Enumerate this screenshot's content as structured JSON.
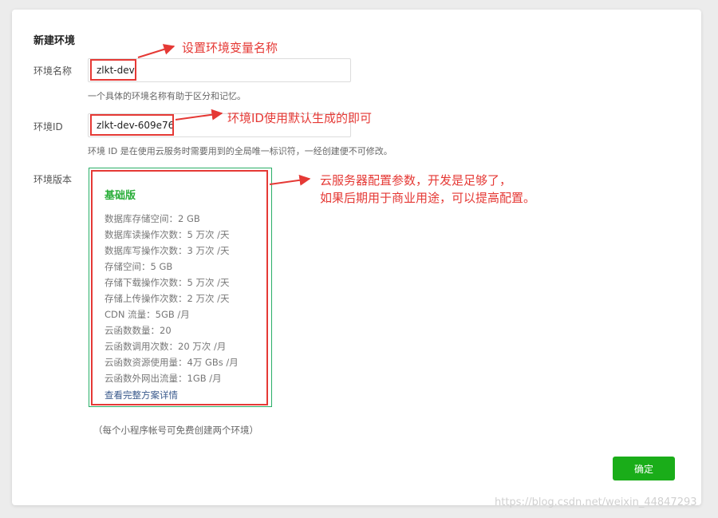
{
  "form": {
    "title": "新建环境",
    "env_name": {
      "label": "环境名称",
      "value": "zlkt-dev",
      "hint": "一个具体的环境名称有助于区分和记忆。"
    },
    "env_id": {
      "label": "环境ID",
      "value": "zlkt-dev-609e76",
      "hint": "环境 ID 是在使用云服务时需要用到的全局唯一标识符，一经创建便不可修改。"
    },
    "env_version": {
      "label": "环境版本",
      "plan": {
        "name": "基础版",
        "specs": [
          "数据库存储空间：2 GB",
          "数据库读操作次数：5 万次 /天",
          "数据库写操作次数：3 万次 /天",
          "存储空间：5 GB",
          "存储下载操作次数：5 万次 /天",
          "存储上传操作次数：2 万次 /天",
          "CDN 流量：5GB /月",
          "云函数数量：20",
          "云函数调用次数：20 万次 /月",
          "云函数资源使用量：4万 GBs /月",
          "云函数外网出流量：1GB /月"
        ],
        "details_link": "查看完整方案详情"
      }
    },
    "footnote": "（每个小程序帐号可免费创建两个环境）",
    "confirm_label": "确定"
  },
  "annotations": {
    "name_note": "设置环境变量名称",
    "id_note": "环境ID使用默认生成的即可",
    "plan_note_line1": "云服务器配置参数，开发是足够了，",
    "plan_note_line2": "如果后期用于商业用途，可以提高配置。"
  },
  "watermark": "https://blog.csdn.net/weixin_44847293",
  "colors": {
    "accent_green": "#1aad19",
    "annotation_red": "#e53935"
  }
}
